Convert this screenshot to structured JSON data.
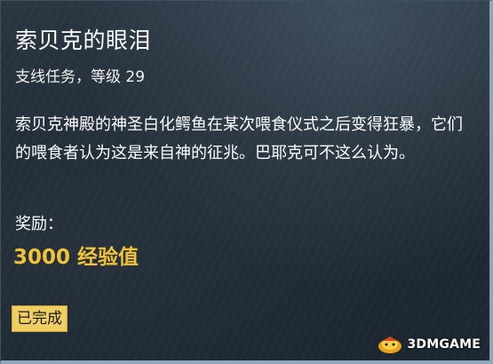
{
  "quest": {
    "title": "索贝克的眼泪",
    "subtitle": "支线任务，等级 29",
    "description": "索贝克神殿的神圣白化鳄鱼在某次喂食仪式之后变得狂暴，它们的喂食者认为这是来自神的征兆。巴耶克可不这么认为。",
    "reward_label": "奖励：",
    "reward_value": "3000 经验值",
    "status": "已完成"
  },
  "watermark": {
    "text": "3DMGAME",
    "logo_icon": "3dm-logo-icon"
  },
  "colors": {
    "background": "#1f2a34",
    "border": "#8fa6bb",
    "reward": "#f2c23a",
    "badge": "#f0ce63"
  }
}
